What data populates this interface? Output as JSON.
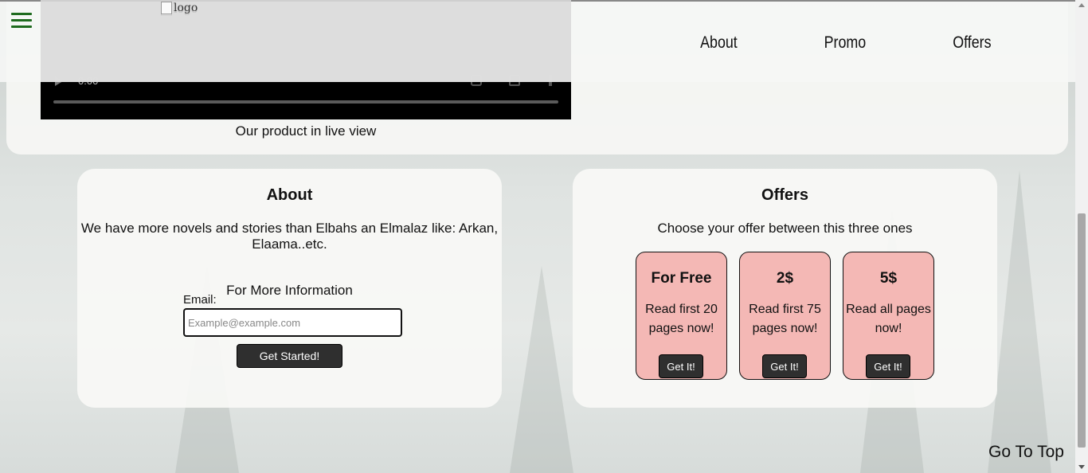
{
  "nav": {
    "logo_alt": "logo",
    "links": [
      "About",
      "Promo",
      "Offers"
    ]
  },
  "video": {
    "time": "0:00",
    "caption": "Our product in live view"
  },
  "about": {
    "title": "About",
    "text": "We have more novels and stories than Elbahs an Elmalaz like: Arkan, Elaama..etc.",
    "more_info": "For More Information",
    "email_label": "Email:",
    "email_placeholder": "Example@example.com",
    "button": "Get Started!"
  },
  "offers": {
    "title": "Offers",
    "subtitle": "Choose your offer between this three ones",
    "items": [
      {
        "title": "For Free",
        "text": "Read first 20 pages now!",
        "button": "Get It!"
      },
      {
        "title": "2$",
        "text": "Read first 75 pages now!",
        "button": "Get It!"
      },
      {
        "title": "5$",
        "text": "Read all pages now!",
        "button": "Get It!"
      }
    ]
  },
  "footer": {
    "go_top": "Go To Top"
  },
  "colors": {
    "accent_green": "#1f6b1f",
    "offer_card": "#f4b8b5",
    "button_dark": "#2f2f2f"
  }
}
